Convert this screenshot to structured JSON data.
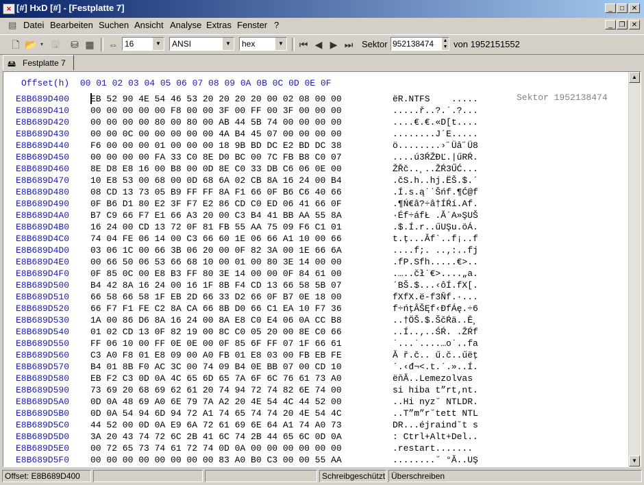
{
  "window": {
    "title": "[#] HxD [#] - [Festplatte 7]",
    "app_icon": "hxd-app-icon",
    "controls": [
      "_",
      "□",
      "✕"
    ],
    "mdi_controls": [
      "_",
      "❐",
      "✕"
    ]
  },
  "menu": [
    "Datei",
    "Bearbeiten",
    "Suchen",
    "Ansicht",
    "Analyse",
    "Extras",
    "Fenster",
    "?"
  ],
  "toolbar": {
    "bytes_per_row": "16",
    "charset": "ANSI",
    "offset_base": "hex",
    "sector_label": "Sektor",
    "sector_value": "952138474",
    "of_label": "von 1952151552"
  },
  "tab": {
    "label": "Festplatte 7"
  },
  "hex": {
    "header_offset": "Offset(h)",
    "header_cols": "00 01 02 03 04 05 06 07 08 09 0A 0B 0C 0D 0E 0F",
    "sector_tag": "Sektor 1952138474",
    "rows": [
      {
        "off": "E8B689D400",
        "hex": "EB 52 90 4E 54 46 53 20 20 20 20 00 02 08 00 00",
        "txt": "ëR.NTFS    ....."
      },
      {
        "off": "E8B689D410",
        "hex": "00 00 00 00 00 F8 00 00 3F 00 FF 00 3F 00 00 00",
        "txt": ".....ř..?.˙.?..."
      },
      {
        "off": "E8B689D420",
        "hex": "00 00 00 00 80 00 80 00 AB 44 5B 74 00 00 00 00",
        "txt": "....€.€.«D[t...."
      },
      {
        "off": "E8B689D430",
        "hex": "00 00 0C 00 00 00 00 00 4A B4 45 07 00 00 00 00",
        "txt": "........J´E....."
      },
      {
        "off": "E8B689D440",
        "hex": "F6 00 00 00 01 00 00 00 18 9B BD DC E2 BD DC 38",
        "txt": "ö........›˝Üâ˝Ü8"
      },
      {
        "off": "E8B689D450",
        "hex": "00 00 00 00 FA 33 C0 8E D0 BC 00 7C FB B8 C0 07",
        "txt": "....ú3ŔŽĐĽ.|űRŔ."
      },
      {
        "off": "E8B689D460",
        "hex": "8E D8 E8 16 00 B8 00 0D 8E C0 33 DB C6 06 0E 00",
        "txt": "ŽŘč..¸..ŽŔ3ŰĆ..."
      },
      {
        "off": "E8B689D470",
        "hex": "10 E8 53 00 68 00 0D 68 6A 02 CB 8A 16 24 00 B4",
        "txt": ".čS.h..hj.ËŠ.$.´"
      },
      {
        "off": "E8B689D480",
        "hex": "08 CD 13 73 05 B9 FF FF 8A F1 66 0F B6 C6 40 66",
        "txt": ".Í.s.ą˙˙Šńf.¶Ć@f"
      },
      {
        "off": "E8B689D490",
        "hex": "0F B6 D1 80 E2 3F F7 E2 86 CD C0 ED 06 41 66 0F",
        "txt": ".¶Ń€â?÷â†ÍŔí.Af."
      },
      {
        "off": "E8B689D4A0",
        "hex": "B7 C9 66 F7 E1 66 A3 20 00 C3 B4 41 BB AA 55 8A",
        "txt": "·Éf÷áfŁ .Ă´A»ŞUŠ"
      },
      {
        "off": "E8B689D4B0",
        "hex": "16 24 00 CD 13 72 0F 81 FB 55 AA 75 09 F6 C1 01",
        "txt": ".$.Í.r..űUŞu.öÁ."
      },
      {
        "off": "E8B689D4C0",
        "hex": "74 04 FE 06 14 00 C3 66 60 1E 06 66 A1 10 00 66",
        "txt": "t.ţ...Ăf`..f¡..f"
      },
      {
        "off": "E8B689D4D0",
        "hex": "03 06 1C 00 66 3B 06 20 00 0F 82 3A 00 1E 66 6A",
        "txt": "....f;. ..‚:..fj"
      },
      {
        "off": "E8B689D4E0",
        "hex": "00 66 50 06 53 66 68 10 00 01 00 80 3E 14 00 00",
        "txt": ".fP.Sfh.....€>.."
      },
      {
        "off": "E8B689D4F0",
        "hex": "0F 85 0C 00 E8 B3 FF 80 3E 14 00 00 0F 84 61 00",
        "txt": ".…..čł˙€>....„a."
      },
      {
        "off": "E8B689D500",
        "hex": "B4 42 8A 16 24 00 16 1F 8B F4 CD 13 66 58 5B 07",
        "txt": "´BŠ.$...‹ôÍ.fX[."
      },
      {
        "off": "E8B689D510",
        "hex": "66 58 66 58 1F EB 2D 66 33 D2 66 0F B7 0E 18 00",
        "txt": "fXfX.ë-f3Ňf.·..."
      },
      {
        "off": "E8B689D520",
        "hex": "66 F7 F1 FE C2 8A CA 66 8B D0 66 C1 EA 10 F7 36",
        "txt": "f÷ńţÂŠĘf‹ĐfÁę.÷6"
      },
      {
        "off": "E8B689D530",
        "hex": "1A 00 86 D6 8A 16 24 00 8A E8 C0 E4 06 0A CC B8",
        "txt": "..†ÖŠ.$.ŠčŔä..Ě¸"
      },
      {
        "off": "E8B689D540",
        "hex": "01 02 CD 13 0F 82 19 00 8C C0 05 20 00 8E C0 66",
        "txt": "..Í..‚..ŚŔ. .ŽŔf"
      },
      {
        "off": "E8B689D550",
        "hex": "FF 06 10 00 FF 0E 0E 00 0F 85 6F FF 07 1F 66 61",
        "txt": "˙...˙....…o˙..fa"
      },
      {
        "off": "E8B689D560",
        "hex": "C3 A0 F8 01 E8 09 00 A0 FB 01 E8 03 00 FB EB FE",
        "txt": "Ă ř.č.. ű.č..űëţ"
      },
      {
        "off": "E8B689D570",
        "hex": "B4 01 8B F0 AC 3C 00 74 09 B4 0E BB 07 00 CD 10",
        "txt": "´.‹đ¬<.t.´.»..Í."
      },
      {
        "off": "E8B689D580",
        "hex": "EB F2 C3 0D 0A 4C 65 6D 65 7A 6F 6C 76 61 73 A0",
        "txt": "ëňĂ..Lemezolvas "
      },
      {
        "off": "E8B689D590",
        "hex": "73 69 20 68 69 62 61 20 74 94 72 74 82 6E 74 00",
        "txt": "si hiba t”rt‚nt."
      },
      {
        "off": "E8B689D5A0",
        "hex": "0D 0A 48 69 A0 6E 79 7A A2 20 4E 54 4C 44 52 00",
        "txt": "..Hi nyz˘ NTLDR."
      },
      {
        "off": "E8B689D5B0",
        "hex": "0D 0A 54 94 6D 94 72 A1 74 65 74 74 20 4E 54 4C",
        "txt": "..T”m”r˘tett NTL"
      },
      {
        "off": "E8B689D5C0",
        "hex": "44 52 00 0D 0A E9 6A 72 61 69 6E 64 A1 74 A0 73",
        "txt": "DR...éjraind˘t s"
      },
      {
        "off": "E8B689D5D0",
        "hex": "3A 20 43 74 72 6C 2B 41 6C 74 2B 44 65 6C 0D 0A",
        "txt": ": Ctrl+Alt+Del.."
      },
      {
        "off": "E8B689D5E0",
        "hex": "00 72 65 73 74 61 72 74 0D 0A 00 00 00 00 00 00",
        "txt": ".restart......."
      },
      {
        "off": "E8B689D5F0",
        "hex": "00 00 00 00 00 00 00 00 83 A0 B0 C3 00 00 55 AA",
        "txt": "........˘ °Ă..UŞ"
      }
    ]
  },
  "status": {
    "offset": "Offset: E8B689D400",
    "empty1": "",
    "empty2": "",
    "readonly": "Schreibgeschützt",
    "mode": "Überschreiben"
  }
}
